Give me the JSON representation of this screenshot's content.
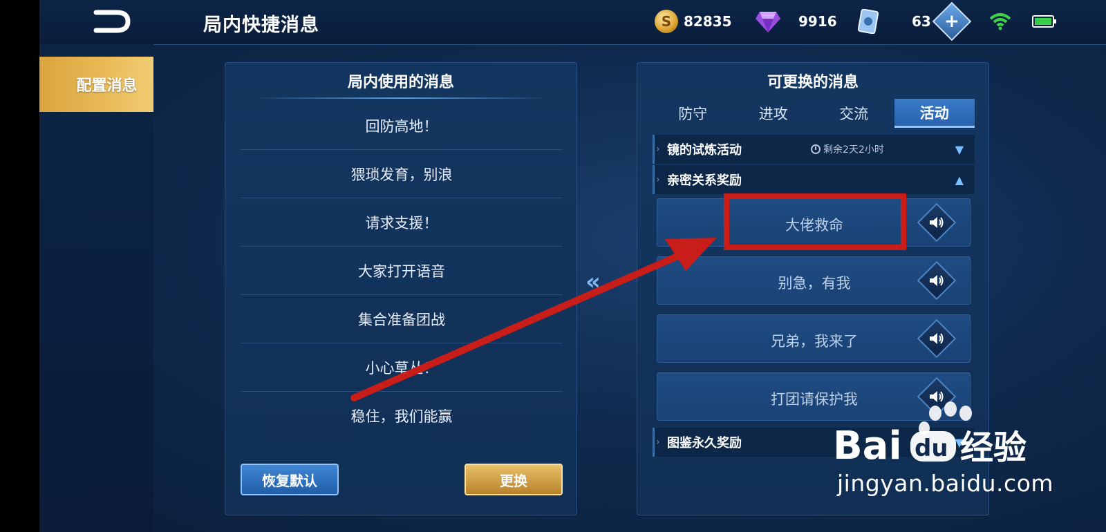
{
  "header": {
    "title": "局内快捷消息",
    "gold": "82835",
    "diamond": "9916",
    "ticket": "63"
  },
  "sidebar": {
    "items": [
      {
        "label": "配置消息",
        "active": true
      }
    ]
  },
  "left_panel": {
    "title": "局内使用的消息",
    "messages": [
      "回防高地！",
      "猥琐发育，别浪",
      "请求支援！",
      "大家打开语音",
      "集合准备团战",
      "小心草丛！",
      "稳住，我们能赢"
    ],
    "restore_label": "恢复默认",
    "change_label": "更换"
  },
  "right_panel": {
    "title": "可更换的消息",
    "tabs": [
      {
        "label": "防守",
        "active": false
      },
      {
        "label": "进攻",
        "active": false
      },
      {
        "label": "交流",
        "active": false
      },
      {
        "label": "活动",
        "active": true
      }
    ],
    "sections": [
      {
        "label": "镜的试炼活动",
        "timer": "剩余2天2小时",
        "expanded": false
      },
      {
        "label": "亲密关系奖励",
        "expanded": true
      },
      {
        "label": "图鉴永久奖励",
        "expanded": false
      }
    ],
    "options": [
      "大佬救命",
      "别急，有我",
      "兄弟，我来了",
      "打团请保护我"
    ]
  },
  "watermark": {
    "brand_a": "Bai",
    "brand_b": "du",
    "brand_c": "经验",
    "url": "jingyan.baidu.com"
  },
  "colors": {
    "accent_gold": "#e9bb58",
    "accent_blue": "#3a7bc8",
    "annotation_red": "#c81d18"
  }
}
